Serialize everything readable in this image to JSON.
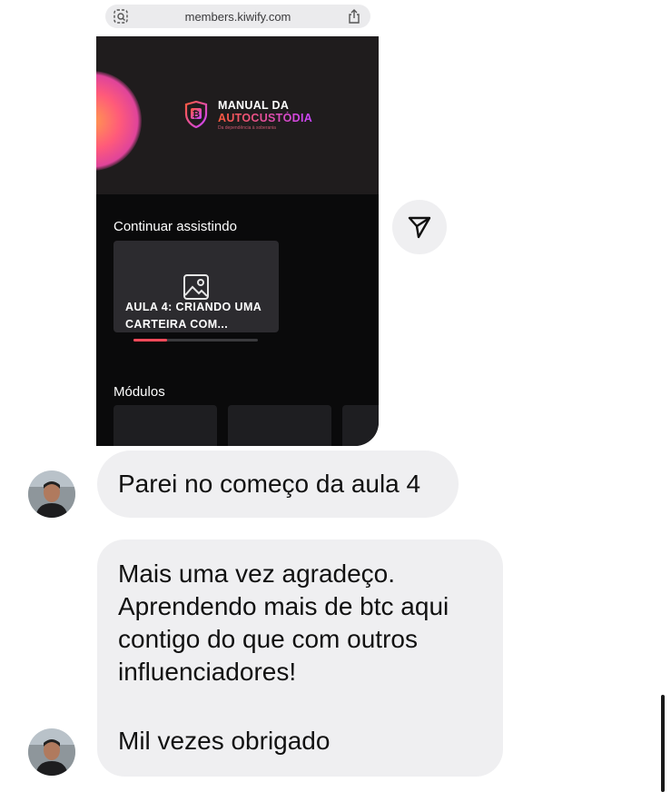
{
  "browser": {
    "url": "members.kiwify.com",
    "left_icon": "site-settings-icon",
    "right_icon": "share-icon"
  },
  "shared_screen": {
    "brand": {
      "line1": "MANUAL DA",
      "line2": "AUTOCUSTÓDIA",
      "tagline": "Da dependência à soberania",
      "icon": "bitcoin-shield-icon"
    },
    "continue_title": "Continuar assistindo",
    "lesson": {
      "title": "AULA 4: CRIANDO UMA CARTEIRA COM...",
      "icon": "image-placeholder-icon",
      "progress": 0.27
    },
    "modules_title": "Módulos"
  },
  "share_button": {
    "icon": "send-icon"
  },
  "messages": [
    {
      "text": "Parei no começo da aula 4"
    },
    {
      "text": "Mais uma vez agradeço.\nAprendendo mais de btc aqui\ncontigo do que com outros\ninfluenciadores!",
      "text2": "Mil vezes obrigado"
    }
  ],
  "colors": {
    "bubble": "#efeff1",
    "accent_progress": "#ff4a5a",
    "dark_bg": "#0a0a0b"
  }
}
